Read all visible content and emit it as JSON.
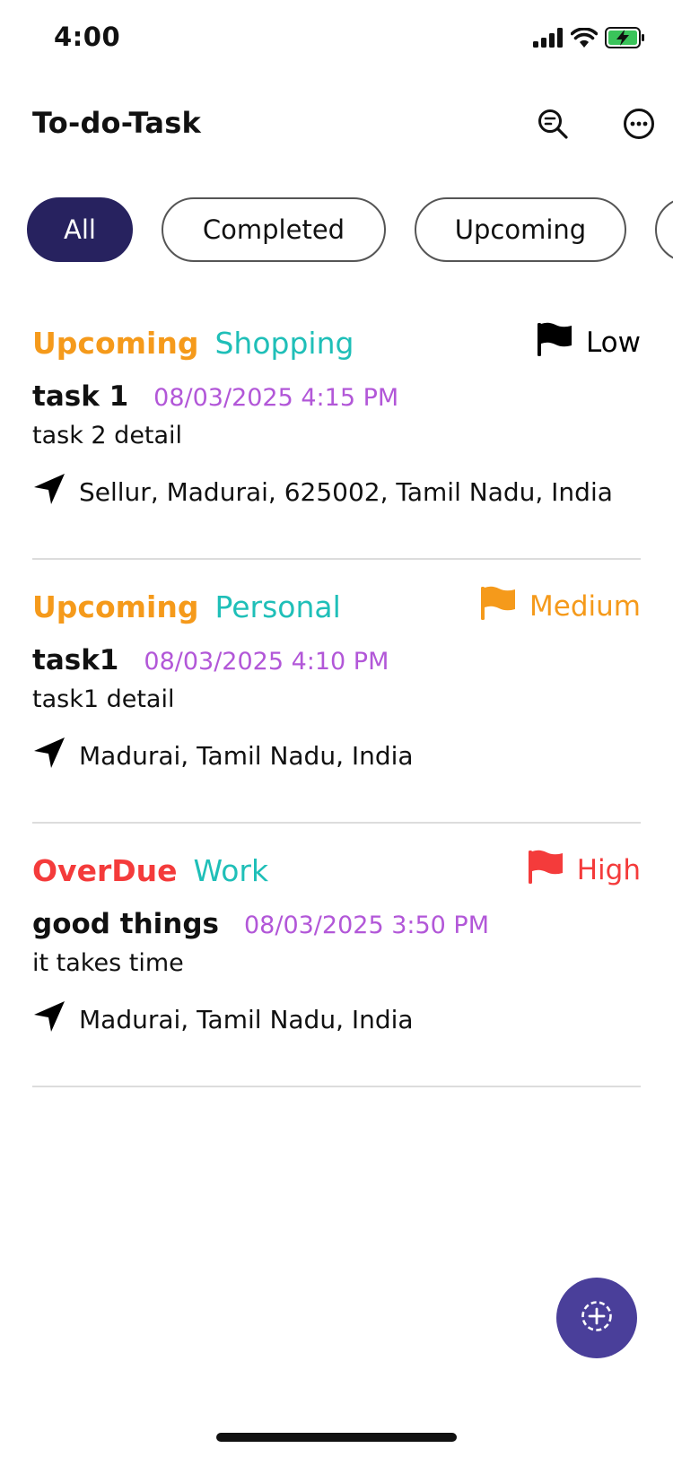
{
  "status_bar": {
    "time": "4:00",
    "icons": [
      "signal-icon",
      "wifi-icon",
      "battery-charging-icon"
    ]
  },
  "header": {
    "title": "To-do-Task",
    "icons": [
      "search-icon",
      "more-icon"
    ]
  },
  "filters": {
    "chips": [
      {
        "label": "All",
        "active": true
      },
      {
        "label": "Completed",
        "active": false
      },
      {
        "label": "Upcoming",
        "active": false
      },
      {
        "label": "",
        "active": false
      }
    ]
  },
  "tasks": [
    {
      "status": "Upcoming",
      "status_color": "#f59a1b",
      "category": "Shopping",
      "priority": "Low",
      "priority_color": "#000000",
      "title": "task 1",
      "date": "08/03/2025 4:15 PM",
      "detail": "task 2 detail",
      "location": "Sellur, Madurai, 625002, Tamil Nadu, India"
    },
    {
      "status": "Upcoming",
      "status_color": "#f59a1b",
      "category": "Personal",
      "priority": "Medium",
      "priority_color": "#f59a1b",
      "title": "task1",
      "date": "08/03/2025 4:10 PM",
      "detail": "task1 detail",
      "location": "Madurai, Tamil Nadu, India"
    },
    {
      "status": "OverDue",
      "status_color": "#f43b3b",
      "category": "Work",
      "priority": "High",
      "priority_color": "#f43b3b",
      "title": "good things",
      "date": "08/03/2025 3:50 PM",
      "detail": "it takes time",
      "location": "Madurai, Tamil Nadu, India"
    }
  ],
  "colors": {
    "accent": "#27225f",
    "fab": "#4a3f9a",
    "category": "#1fbfb8",
    "date": "#b257d8"
  },
  "fab": {
    "icon": "add-circle-icon"
  }
}
